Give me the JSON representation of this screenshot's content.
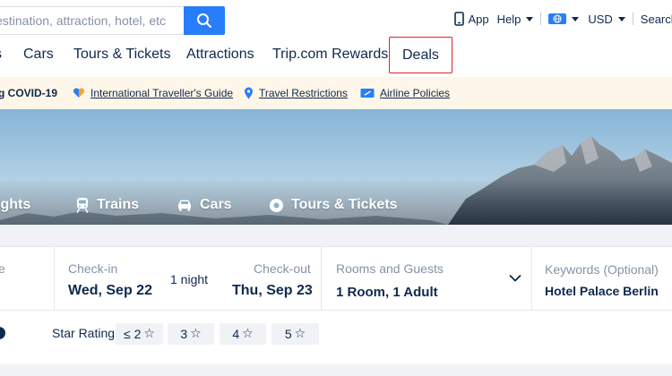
{
  "top": {
    "search_placeholder": "Destination, attraction, hotel, etc",
    "app_label": "App",
    "help_label": "Help",
    "currency_label": "USD",
    "search_label": "Search"
  },
  "nav": {
    "items": [
      "s",
      "Cars",
      "Tours & Tickets",
      "Attractions",
      "Trip.com Rewards",
      "Deals"
    ]
  },
  "covid": {
    "heading": "g COVID-19",
    "links": [
      "International Traveller's Guide",
      "Travel Restrictions",
      "Airline Policies"
    ]
  },
  "hero": {
    "tabs": [
      "ights",
      "Trains",
      "Cars",
      "Tours & Tickets"
    ]
  },
  "booking": {
    "dest_label_fragment": "e",
    "checkin_label": "Check-in",
    "checkin_value": "Wed, Sep 22",
    "nights": "1 night",
    "checkout_label": "Check-out",
    "checkout_value": "Thu, Sep 23",
    "guests_label": "Rooms and Guests",
    "guests_value": "1 Room, 1 Adult",
    "keywords_label": "Keywords (Optional)",
    "keywords_value": "Hotel Palace Berlin"
  },
  "filters": {
    "star_label": "Star Rating",
    "star_options": [
      "≤ 2",
      "3",
      "4",
      "5"
    ]
  },
  "colors": {
    "brand_blue": "#287dfa",
    "text_dark": "#0f294d",
    "highlight_red": "#e0212a",
    "banner_bg": "#fef6e9"
  }
}
